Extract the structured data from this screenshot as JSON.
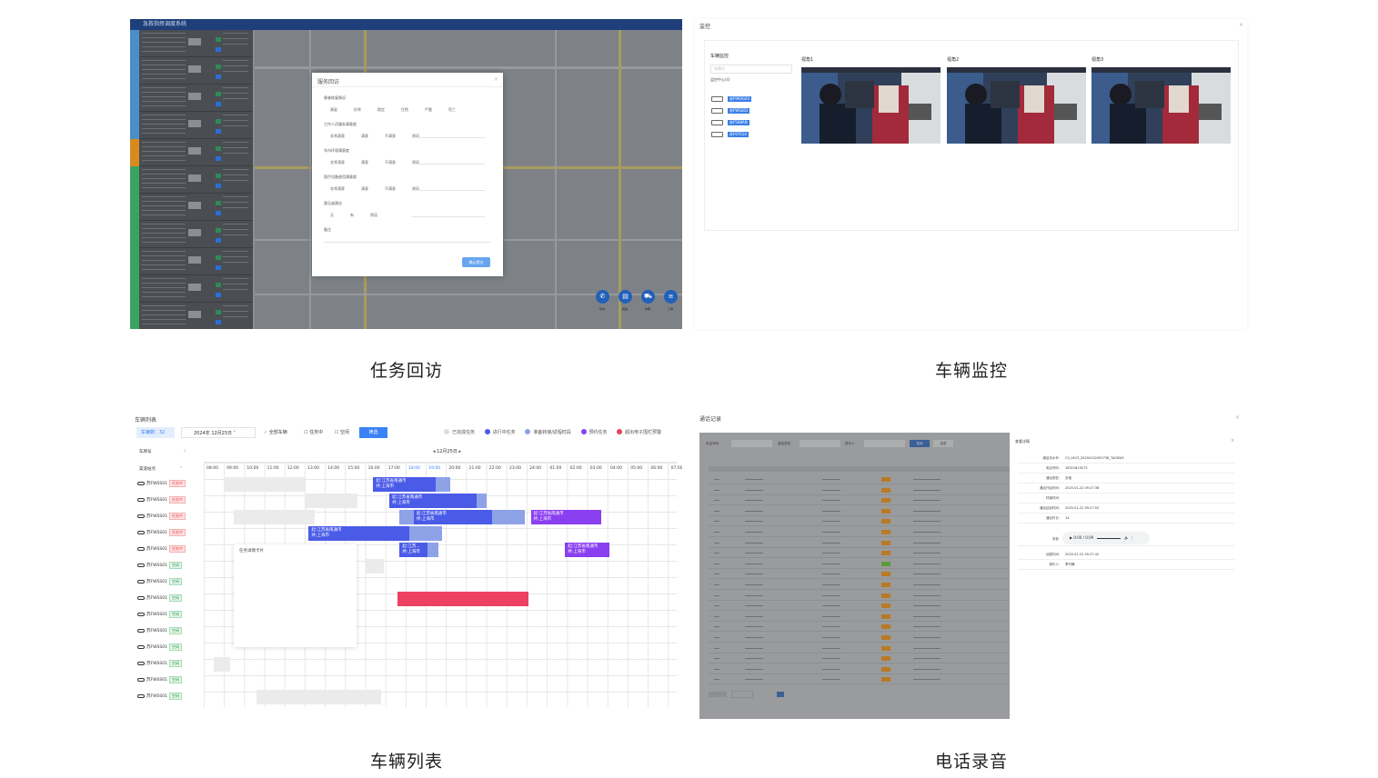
{
  "captions": {
    "p1": "任务回访",
    "p2": "车辆监控",
    "p3": "车辆列表",
    "p4": "电话录音"
  },
  "p1": {
    "app_title": "急救指挥调度系统",
    "modal": {
      "title": "服务回访",
      "close": "×",
      "q1": "患者恢复情况",
      "q1_opts": [
        "康复",
        "好转",
        "稳定",
        "住院",
        "严重",
        "死亡"
      ],
      "q2": "工作人员服务满意度",
      "q3": "车内环境满意度",
      "q4": "医疗设备使用满意度",
      "sat_opts": [
        "非常满意",
        "满意",
        "不满意",
        "原因"
      ],
      "q5": "意见或建议",
      "sugg_opts": [
        "无",
        "有",
        "原因"
      ],
      "q6": "备注",
      "confirm": "确认提交"
    },
    "tools": [
      "呼叫",
      "档案",
      "车辆",
      "工单"
    ]
  },
  "p2": {
    "title": "监控",
    "close": "×",
    "side_title": "车辆监控",
    "search_placeholder": "车牌号",
    "center": "监控中心(4)",
    "plates": [
      "苏F969G03",
      "苏FWSS01",
      "苏F568AN",
      "苏F6YS14"
    ],
    "views": [
      "视角1",
      "视角2",
      "视角3"
    ]
  },
  "p3": {
    "title": "车辆列表",
    "count": "车辆数：32",
    "date": "2024年 12月25日",
    "all_vehicles": "全部车辆",
    "on_task": "任务中",
    "idle": "空闲",
    "filter": "筛选",
    "legend": [
      {
        "label": "已完成任务",
        "color": "#dddddd"
      },
      {
        "label": "进行中任务",
        "color": "#4a5be8"
      },
      {
        "label": "准备转接/返程时段",
        "color": "#8ea2e8"
      },
      {
        "label": "预约任务",
        "color": "#8a3ff0"
      },
      {
        "label": "超出电子围栏预警",
        "color": "#ee4060"
      }
    ],
    "plate_header": "车牌号",
    "station_header": "渠道站点",
    "day_nav": "12月25日",
    "hours": [
      "08:00",
      "09:00",
      "10:00",
      "11:00",
      "12:00",
      "13:00",
      "14:00",
      "15:00",
      "16:00",
      "17:00",
      "18:00",
      "19:00",
      "20:00",
      "21:00",
      "22:00",
      "23:00",
      "24:00",
      "01:00",
      "02:00",
      "03:00",
      "04:00",
      "05:00",
      "06:00",
      "07:00"
    ],
    "rows": [
      {
        "plate": "苏FWSS01",
        "status": "任务中"
      },
      {
        "plate": "苏FWSS01",
        "status": "任务中"
      },
      {
        "plate": "苏FWSS01",
        "status": "任务中"
      },
      {
        "plate": "苏FWSS01",
        "status": "任务中"
      },
      {
        "plate": "苏FWSS01",
        "status": "任务中"
      },
      {
        "plate": "苏FWSS01",
        "status": "空闲"
      },
      {
        "plate": "苏FWSS01",
        "status": "空闲"
      },
      {
        "plate": "苏FWSS01",
        "status": "空闲"
      },
      {
        "plate": "苏FWSS01",
        "status": "空闲"
      },
      {
        "plate": "苏FWSS01",
        "status": "空闲"
      },
      {
        "plate": "苏FWSS01",
        "status": "空闲"
      },
      {
        "plate": "苏FWSS01",
        "status": "空闲"
      },
      {
        "plate": "苏FWSS01",
        "status": "空闲"
      },
      {
        "plate": "苏FWSS01",
        "status": "空闲"
      }
    ],
    "bar_text_1": "起:江苏省南通市",
    "bar_text_2": "终:上海市",
    "bar_short": "起:江苏...",
    "card_title": "任务详情卡片"
  },
  "p4": {
    "title": "通话记录",
    "close": "×",
    "filter_phone": "电话号码",
    "filter_type": "通话类型",
    "filter_op": "操作人",
    "search": "查询",
    "reset": "重置",
    "detail_title": "查看详情",
    "detail_close": "×",
    "detail": [
      {
        "k": "通话流水号:",
        "v": "C0_0013_20250122092738_TAOXW2"
      },
      {
        "k": "电话号码:",
        "v": "18321819273"
      },
      {
        "k": "通话类型:",
        "v": "去电"
      },
      {
        "k": "通话开始时间:",
        "v": "2025-01-22 09:27:38"
      },
      {
        "k": "呼通时间:",
        "v": ""
      },
      {
        "k": "通话结束时间:",
        "v": "2025-01-22 09:27:52"
      },
      {
        "k": "通话时长:",
        "v": "14"
      }
    ],
    "audio_label": "录音:",
    "audio_time": "0:00 / 0:09",
    "created_label": "创建时间:",
    "created": "2025-01-22 09:27:42",
    "operator_label": "操作人:",
    "operator": "李行静"
  }
}
